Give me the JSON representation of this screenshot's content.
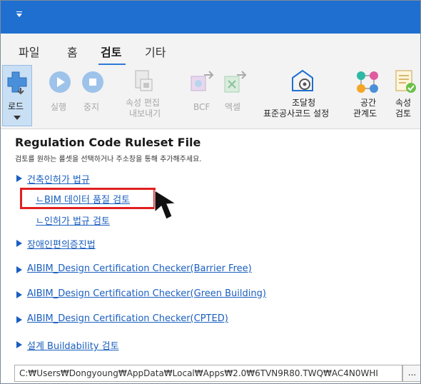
{
  "menu": {
    "tabs": [
      "파일",
      "홈",
      "검토",
      "기타"
    ],
    "active_tab": "검토"
  },
  "ribbon": {
    "load": "로드",
    "run": "실행",
    "stop": "중지",
    "property_edit": "속성 편집",
    "property_export": "내보내기",
    "bcf": "BCF",
    "excel": "엑셀",
    "procurement_line1": "조달청",
    "procurement_line2": "표준공사코드 설정",
    "space_line1": "공간",
    "space_line2": "관계도",
    "attr_line1": "속성",
    "attr_line2": "검토"
  },
  "content": {
    "title": "Regulation Code Ruleset File",
    "subtitle": "검토를 원하는 룰셋을 선택하거나 주소창을 통해 추가해주세요.",
    "items": {
      "building_permit": "건축인허가 법규",
      "bim_quality": "ㄴBIM 데이터 품질 검토",
      "permit_review": "ㄴ인허가 법규 검토",
      "disability": "장애인편의증진법",
      "barrier_free": "AIBIM_Design Certification Checker(Barrier Free)",
      "green_building": "AIBIM_Design Certification Checker(Green Building)",
      "cpted": "AIBIM_Design Certification Checker(CPTED)",
      "buildability": "설계 Buildability 검토"
    },
    "path": "C:₩Users₩Dongyoung₩AppData₩Local₩Apps₩2.0₩6TVN9R80.TWQ₩AC4N0WHI",
    "browse": "..."
  },
  "colors": {
    "titlebar": "#1f6fd0",
    "link": "#1a5fbf",
    "highlight": "#e02020",
    "accent": "#2f7ad8"
  },
  "icons": [
    "quick-access-icon",
    "load-icon",
    "play-icon",
    "stop-icon",
    "property-edit-icon",
    "bcf-icon",
    "excel-icon",
    "procurement-settings-icon",
    "space-graph-icon",
    "attribute-check-icon",
    "mouse-cursor-icon"
  ]
}
